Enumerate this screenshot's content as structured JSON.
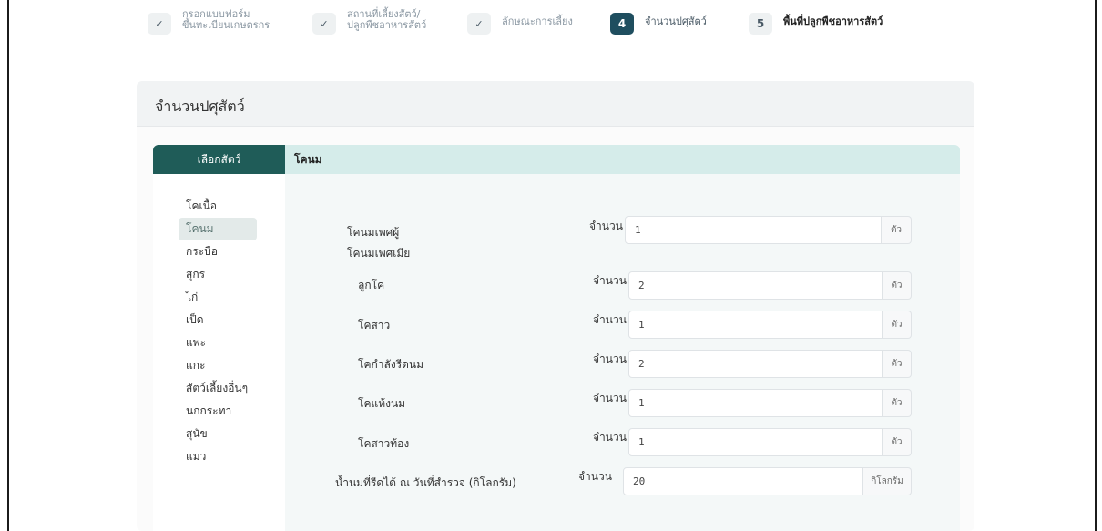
{
  "stepper": {
    "steps": [
      {
        "number": "",
        "label": "กรอกแบบฟอร์ม\nขึ้นทะเบียนเกษตรกร",
        "state": "done"
      },
      {
        "number": "",
        "label": "สถานที่เลี้ยงสัตว์/\nปลูกพืชอาหารสัตว์",
        "state": "done"
      },
      {
        "number": "",
        "label": "ลักษณะการเลี้ยง",
        "state": "done"
      },
      {
        "number": "4",
        "label": "จำนวนปศุสัตว์",
        "state": "active"
      },
      {
        "number": "5",
        "label": "พื้นที่ปลูกพืชอาหารสัตว์",
        "state": "pending"
      }
    ],
    "check_glyph": "✓"
  },
  "card": {
    "title": "จำนวนปศุสัตว์",
    "left_header": "เลือกสัตว์",
    "right_header": "โคนม"
  },
  "animals": [
    "โคเนื้อ",
    "โคนม",
    "กระบือ",
    "สุกร",
    "ไก่",
    "เป็ด",
    "แพะ",
    "แกะ",
    "สัตว์เลี้ยงอื่นๆ",
    "นกกระทา",
    "สุนัข",
    "แมว"
  ],
  "active_animal": "โคนม",
  "form": {
    "qty_label": "จำนวน",
    "male": {
      "label": "โคนมเพศผู้",
      "value": "1",
      "unit": "ตัว"
    },
    "female_heading": "โคนมเพศเมีย",
    "female_rows": [
      {
        "label": "ลูกโค",
        "value": "2",
        "unit": "ตัว"
      },
      {
        "label": "โคสาว",
        "value": "1",
        "unit": "ตัว"
      },
      {
        "label": "โคกำลังรีดนม",
        "value": "2",
        "unit": "ตัว"
      },
      {
        "label": "โคแห้งนม",
        "value": "1",
        "unit": "ตัว"
      },
      {
        "label": "โคสาวท้อง",
        "value": "1",
        "unit": "ตัว"
      }
    ],
    "milk": {
      "label": "น้ำนมที่รีดได้ ณ วันที่สำรวจ (กิโลกรัม)",
      "value": "20",
      "unit": "กิโลกรัม"
    }
  },
  "colors": {
    "primary": "#1f5c58",
    "active_step": "#1f4e5f",
    "header_light": "#d5ecea"
  }
}
